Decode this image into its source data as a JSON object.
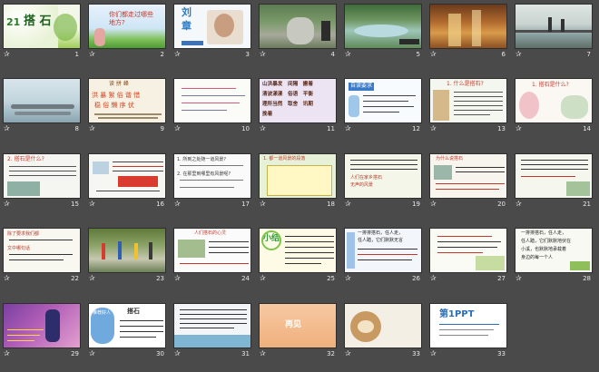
{
  "slides": [
    {
      "num": "1",
      "text": [
        "21",
        "搭 石"
      ]
    },
    {
      "num": "2",
      "text": [
        "你们都走过哪些",
        "地方?"
      ]
    },
    {
      "num": "3",
      "text": [
        "刘",
        "章"
      ]
    },
    {
      "num": "4",
      "text": []
    },
    {
      "num": "5",
      "text": []
    },
    {
      "num": "6",
      "text": []
    },
    {
      "num": "7",
      "text": []
    },
    {
      "num": "8",
      "text": []
    },
    {
      "num": "9",
      "text": [
        "读 拼 峰",
        "洪 暴 絮 俗 谐 惜",
        "稳 俗 懒 序 伏"
      ]
    },
    {
      "num": "10",
      "text": []
    },
    {
      "num": "11",
      "text": [
        "山洪暴发　间隔　搬着",
        "清波漾漾　俗语　平衡",
        "理所当然　取舍　讯期",
        "挽着"
      ]
    },
    {
      "num": "12",
      "text": [
        "自读要求"
      ]
    },
    {
      "num": "13",
      "text": [
        "1. 什么是搭石?"
      ]
    },
    {
      "num": "14",
      "text": [
        "1. 搭石是什么?"
      ]
    },
    {
      "num": "15",
      "text": [
        "2. 搭石是什么?"
      ]
    },
    {
      "num": "16",
      "text": []
    },
    {
      "num": "17",
      "text": [
        "1. 所到之处随一道风景?",
        "2. 在那里到哪里有风景呢?"
      ]
    },
    {
      "num": "18",
      "text": [
        "1. 都一道风景的段落"
      ]
    },
    {
      "num": "19",
      "text": [
        "人们在家乡搭石",
        "无声的风景"
      ]
    },
    {
      "num": "20",
      "text": [
        "为什么说搭石"
      ]
    },
    {
      "num": "21",
      "text": []
    },
    {
      "num": "22",
      "text": [
        "除了要求我们都",
        "文中哪句话"
      ]
    },
    {
      "num": "23",
      "text": []
    },
    {
      "num": "24",
      "text": [
        "人们搭石的心灵"
      ]
    },
    {
      "num": "25",
      "text": [
        "小结"
      ]
    },
    {
      "num": "26",
      "text": [
        "一排排搭石，任人走，",
        "任人踏，它们默默无言"
      ]
    },
    {
      "num": "27",
      "text": []
    },
    {
      "num": "28",
      "text": [
        "一排排搭石，任人走，",
        "任人踏，它们默默地伏在",
        "小溪，也默默地承载着",
        "身边的每一个人"
      ]
    },
    {
      "num": "29",
      "text": []
    },
    {
      "num": "30",
      "text": [
        "推荐好人",
        "搭石"
      ]
    },
    {
      "num": "31",
      "text": []
    },
    {
      "num": "32",
      "text": [
        "再见"
      ]
    },
    {
      "num": "33",
      "text": [
        "第1PPT"
      ]
    }
  ]
}
